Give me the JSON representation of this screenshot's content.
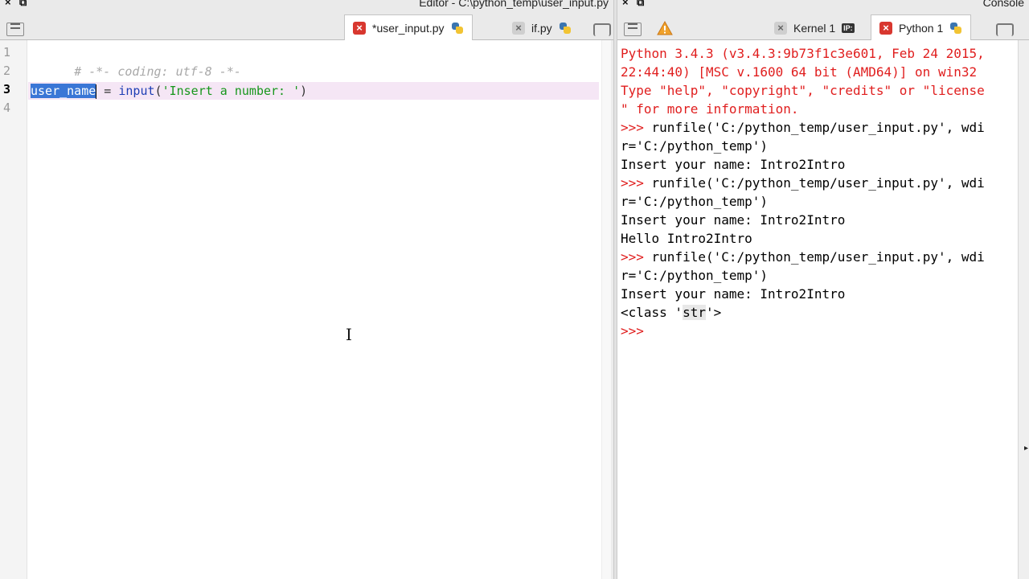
{
  "editor": {
    "title": "Editor - C:\\python_temp\\user_input.py",
    "tabs": [
      {
        "label": "*user_input.py",
        "active": true
      },
      {
        "label": "if.py",
        "active": false
      }
    ],
    "line_numbers": [
      "1",
      "2",
      "3",
      "4"
    ],
    "code": {
      "line1": "# -*- coding: utf-8 -*-",
      "line3_var": "user_name",
      "line3_eq": " = ",
      "line3_func": "input",
      "line3_open": "(",
      "line3_str": "'Insert a number: '",
      "line3_close": ")"
    }
  },
  "console": {
    "title": "Console",
    "tabs": [
      {
        "label": "Kernel 1",
        "active": false
      },
      {
        "label": "Python 1",
        "active": true
      }
    ],
    "banner": [
      "Python 3.4.3 (v3.4.3:9b73f1c3e601, Feb 24 2015,",
      "22:44:40) [MSC v.1600 64 bit (AMD64)] on win32",
      "Type \"help\", \"copyright\", \"credits\" or \"license",
      "\" for more information."
    ],
    "prompt": ">>>",
    "run_cmd_1": " runfile('C:/python_temp/user_input.py', wdi",
    "run_cmd_2": "r='C:/python_temp')",
    "output_insert": "Insert your name: Intro2Intro",
    "output_hello": "Hello Intro2Intro",
    "output_class_pre": "<class '",
    "output_class_str": "str",
    "output_class_post": "'>"
  },
  "colors": {
    "selection": "#3a76d6",
    "console_error": "#e01e1e",
    "string": "#17961c",
    "builtin": "#1f3fb5"
  }
}
